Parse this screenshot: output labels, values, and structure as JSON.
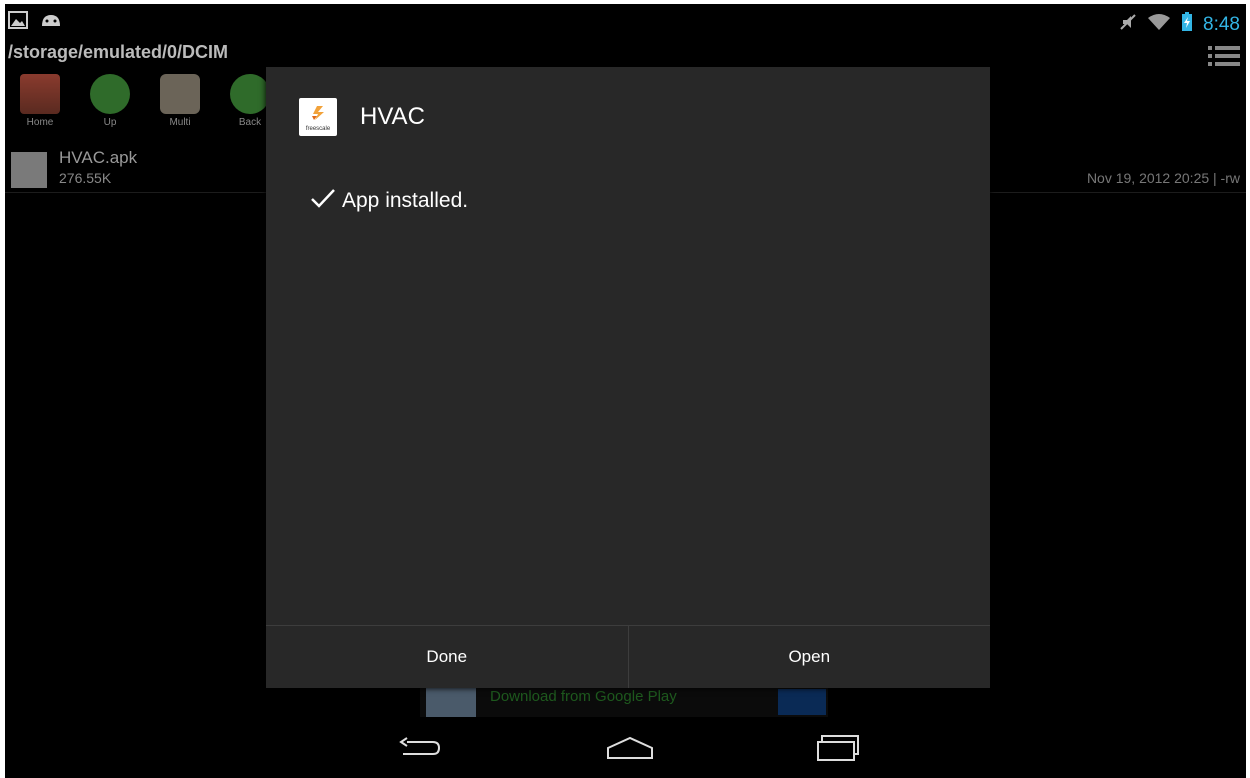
{
  "status_bar": {
    "time": "8:48",
    "left_icons": [
      "gallery-icon",
      "android-icon"
    ],
    "right_icons": [
      "mute-icon",
      "wifi-icon",
      "battery-charging-icon"
    ]
  },
  "background_app": {
    "path": "/storage/emulated/0/DCIM",
    "toolbar": [
      {
        "label": "Home",
        "icon": "home-icon"
      },
      {
        "label": "Up",
        "icon": "up-arrow-icon"
      },
      {
        "label": "Multi",
        "icon": "multi-select-icon"
      },
      {
        "label": "Back",
        "icon": "back-arrow-icon"
      }
    ],
    "file": {
      "name": "HVAC.apk",
      "size": "276.55K",
      "meta": "Nov 19, 2012 20:25 | -rw"
    },
    "ad": {
      "text": "Download from Google Play"
    }
  },
  "dialog": {
    "title": "HVAC",
    "app_icon_text": "freescale",
    "message": "App installed.",
    "buttons": {
      "done": "Done",
      "open": "Open"
    }
  },
  "nav": {
    "back": "back-icon",
    "home": "home-icon",
    "recents": "recents-icon"
  },
  "colors": {
    "clock": "#33b5e5",
    "dialog_bg": "#282828"
  }
}
